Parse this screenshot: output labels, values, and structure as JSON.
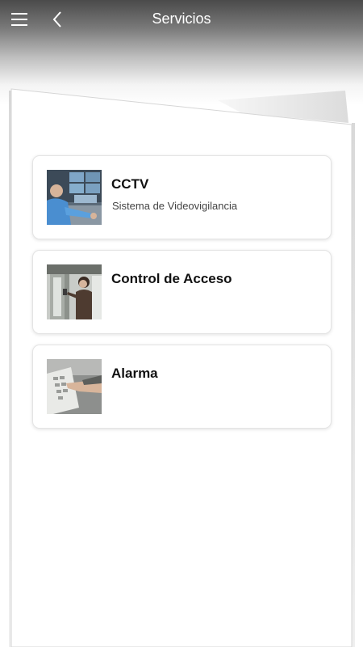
{
  "header": {
    "title": "Servicios",
    "menu_icon": "hamburger-menu-icon",
    "back_icon": "chevron-left-icon"
  },
  "services": [
    {
      "title": "CCTV",
      "subtitle": "Sistema de Videovigilancia",
      "image": "cctv-operator-monitors-photo"
    },
    {
      "title": "Control de Acceso",
      "subtitle": "",
      "image": "access-control-door-photo"
    },
    {
      "title": "Alarma",
      "subtitle": "",
      "image": "alarm-keypad-photo"
    }
  ],
  "colors": {
    "header_dark": "#4a4a4a",
    "header_text": "#ffffff",
    "card_border": "#e4e4e4",
    "title_text": "#111111",
    "subtitle_text": "#444444"
  }
}
